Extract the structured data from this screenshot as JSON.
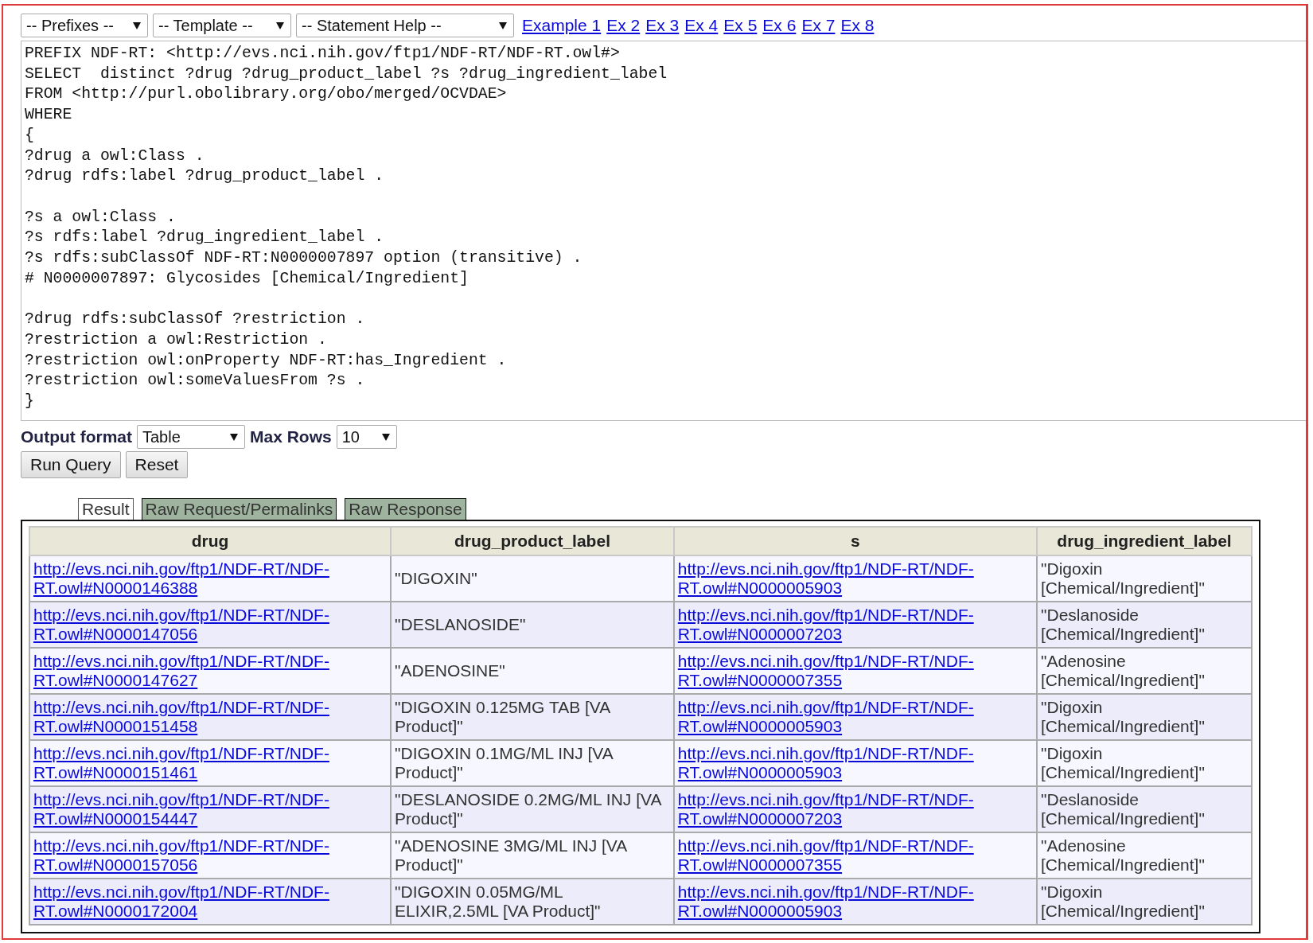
{
  "toolbar": {
    "dropdowns": [
      {
        "value": "-- Prefixes --"
      },
      {
        "value": "-- Template --"
      },
      {
        "value": "-- Statement Help --"
      }
    ],
    "examples": [
      "Example 1",
      "Ex 2",
      "Ex 3",
      "Ex 4",
      "Ex 5",
      "Ex 6",
      "Ex 7",
      "Ex 8"
    ]
  },
  "query": {
    "value": "PREFIX NDF-RT: <http://evs.nci.nih.gov/ftp1/NDF-RT/NDF-RT.owl#>\nSELECT  distinct ?drug ?drug_product_label ?s ?drug_ingredient_label\nFROM <http://purl.obolibrary.org/obo/merged/OCVDAE>\nWHERE\n{\n?drug a owl:Class .\n?drug rdfs:label ?drug_product_label .\n\n?s a owl:Class .\n?s rdfs:label ?drug_ingredient_label .\n?s rdfs:subClassOf NDF-RT:N0000007897 option (transitive) .\n# N0000007897: Glycosides [Chemical/Ingredient]\n\n?drug rdfs:subClassOf ?restriction .\n?restriction a owl:Restriction .\n?restriction owl:onProperty NDF-RT:has_Ingredient .\n?restriction owl:someValuesFrom ?s .\n}"
  },
  "options": [
    {
      "label": "Output format",
      "value": "Table",
      "kind": "wide"
    },
    {
      "label": "Max Rows",
      "value": "10",
      "kind": "narrow"
    }
  ],
  "buttons": [
    "Run Query",
    "Reset"
  ],
  "tabs": [
    {
      "label": "Result",
      "selected": true
    },
    {
      "label": "Raw Request/Permalinks",
      "selected": false
    },
    {
      "label": "Raw Response",
      "selected": false
    }
  ],
  "table": {
    "columns": [
      {
        "label": "drug",
        "kind": "link"
      },
      {
        "label": "drug_product_label",
        "kind": "text"
      },
      {
        "label": "s",
        "kind": "link"
      },
      {
        "label": "drug_ingredient_label",
        "kind": "text"
      }
    ],
    "rows": [
      [
        "http://evs.nci.nih.gov/ftp1/NDF-RT/NDF-RT.owl#N0000146388",
        "\"DIGOXIN\"",
        "http://evs.nci.nih.gov/ftp1/NDF-RT/NDF-RT.owl#N0000005903",
        "\"Digoxin [Chemical/Ingredient]\""
      ],
      [
        "http://evs.nci.nih.gov/ftp1/NDF-RT/NDF-RT.owl#N0000147056",
        "\"DESLANOSIDE\"",
        "http://evs.nci.nih.gov/ftp1/NDF-RT/NDF-RT.owl#N0000007203",
        "\"Deslanoside [Chemical/Ingredient]\""
      ],
      [
        "http://evs.nci.nih.gov/ftp1/NDF-RT/NDF-RT.owl#N0000147627",
        "\"ADENOSINE\"",
        "http://evs.nci.nih.gov/ftp1/NDF-RT/NDF-RT.owl#N0000007355",
        "\"Adenosine [Chemical/Ingredient]\""
      ],
      [
        "http://evs.nci.nih.gov/ftp1/NDF-RT/NDF-RT.owl#N0000151458",
        "\"DIGOXIN 0.125MG TAB [VA Product]\"",
        "http://evs.nci.nih.gov/ftp1/NDF-RT/NDF-RT.owl#N0000005903",
        "\"Digoxin [Chemical/Ingredient]\""
      ],
      [
        "http://evs.nci.nih.gov/ftp1/NDF-RT/NDF-RT.owl#N0000151461",
        "\"DIGOXIN 0.1MG/ML INJ [VA Product]\"",
        "http://evs.nci.nih.gov/ftp1/NDF-RT/NDF-RT.owl#N0000005903",
        "\"Digoxin [Chemical/Ingredient]\""
      ],
      [
        "http://evs.nci.nih.gov/ftp1/NDF-RT/NDF-RT.owl#N0000154447",
        "\"DESLANOSIDE 0.2MG/ML INJ [VA Product]\"",
        "http://evs.nci.nih.gov/ftp1/NDF-RT/NDF-RT.owl#N0000007203",
        "\"Deslanoside [Chemical/Ingredient]\""
      ],
      [
        "http://evs.nci.nih.gov/ftp1/NDF-RT/NDF-RT.owl#N0000157056",
        "\"ADENOSINE 3MG/ML INJ [VA Product]\"",
        "http://evs.nci.nih.gov/ftp1/NDF-RT/NDF-RT.owl#N0000007355",
        "\"Adenosine [Chemical/Ingredient]\""
      ],
      [
        "http://evs.nci.nih.gov/ftp1/NDF-RT/NDF-RT.owl#N0000172004",
        "\"DIGOXIN 0.05MG/ML ELIXIR,2.5ML [VA Product]\"",
        "http://evs.nci.nih.gov/ftp1/NDF-RT/NDF-RT.owl#N0000005903",
        "\"Digoxin [Chemical/Ingredient]\""
      ]
    ]
  }
}
